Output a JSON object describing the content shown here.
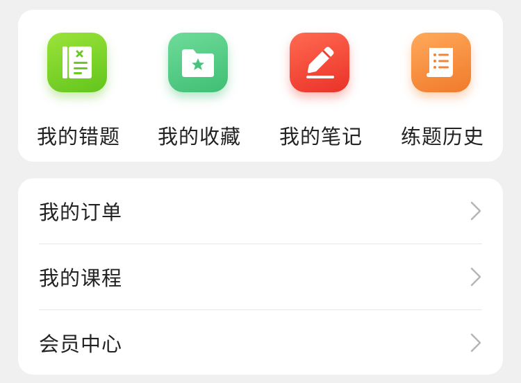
{
  "quick_actions": [
    {
      "label": "我的错题",
      "icon": "wrong-questions-notebook-icon",
      "color": "#7ED321"
    },
    {
      "label": "我的收藏",
      "icon": "favorites-folder-star-icon",
      "color": "#52CC85"
    },
    {
      "label": "我的笔记",
      "icon": "notes-pen-icon",
      "color": "#F04A3C"
    },
    {
      "label": "练题历史",
      "icon": "history-scroll-icon",
      "color": "#F58A3A"
    }
  ],
  "menu": {
    "items": [
      {
        "label": "我的订单",
        "icon": "chevron-right-icon"
      },
      {
        "label": "我的课程",
        "icon": "chevron-right-icon"
      },
      {
        "label": "会员中心",
        "icon": "chevron-right-icon"
      }
    ]
  }
}
